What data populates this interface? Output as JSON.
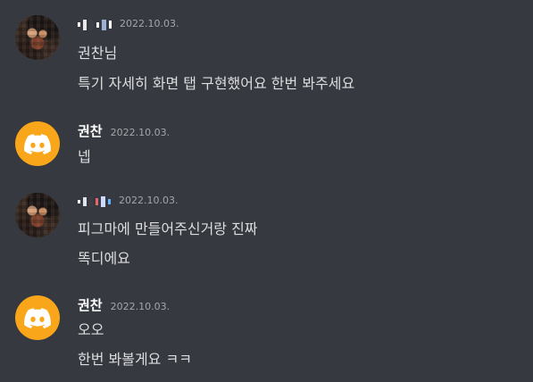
{
  "messages": [
    {
      "author": "",
      "author_obscured": true,
      "avatar": "user-photo-avatar",
      "timestamp": "2022.10.03.",
      "lines": [
        "권찬님",
        "특기 자세히 화면 탭 구현했어요 한번 봐주세요"
      ]
    },
    {
      "author": "권찬",
      "avatar": "discord-icon",
      "avatar_color": "#faa61a",
      "timestamp": "2022.10.03.",
      "lines": [
        "넵"
      ]
    },
    {
      "author": "",
      "author_obscured": true,
      "avatar": "user-photo-avatar",
      "timestamp": "2022.10.03.",
      "lines": [
        "피그마에 만들어주신거랑 진짜",
        "똑디에요"
      ]
    },
    {
      "author": "권찬",
      "avatar": "discord-icon",
      "avatar_color": "#faa61a",
      "timestamp": "2022.10.03.",
      "lines": [
        "오오",
        "한번 봐볼게요 ㅋㅋ"
      ]
    }
  ],
  "colors": {
    "background": "#36393f",
    "username": "#ffffff",
    "timestamp": "#a3a6aa",
    "message_text": "#dcddde",
    "bot_avatar": "#faa61a"
  }
}
